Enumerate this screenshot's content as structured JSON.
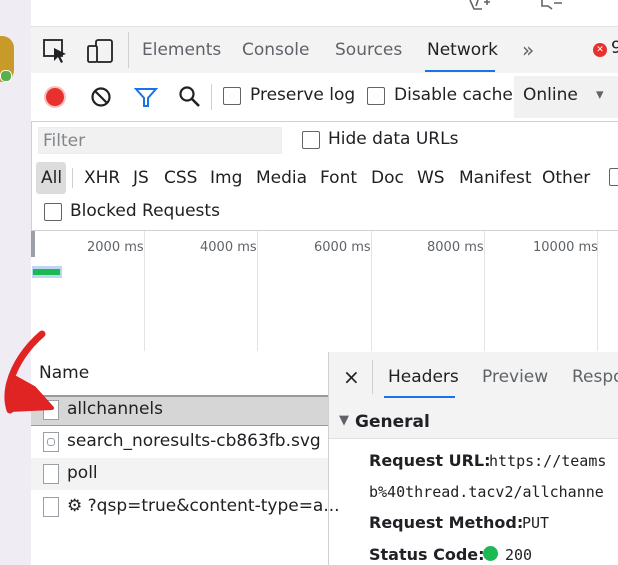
{
  "devtools": {
    "tabs": [
      {
        "label": "Elements"
      },
      {
        "label": "Console"
      },
      {
        "label": "Sources"
      },
      {
        "label": "Network"
      }
    ],
    "more_tabs_glyph": "»",
    "error_glyph": "✕",
    "error_count": "9"
  },
  "toolbar": {
    "preserve_log": "Preserve log",
    "disable_cache": "Disable cache",
    "throttle": "Online",
    "throttle_caret": "▾"
  },
  "filter": {
    "placeholder": "Filter",
    "hide_data_urls": "Hide data URLs",
    "types": [
      "All",
      "XHR",
      "JS",
      "CSS",
      "Img",
      "Media",
      "Font",
      "Doc",
      "WS",
      "Manifest",
      "Other"
    ],
    "blocked_requests": "Blocked Requests"
  },
  "timeline": {
    "ticks": [
      "2000 ms",
      "4000 ms",
      "6000 ms",
      "8000 ms",
      "10000 ms"
    ]
  },
  "requests": {
    "column_name": "Name",
    "rows": [
      {
        "name": "allchannels"
      },
      {
        "name": "search_noresults-cb863fb.svg"
      },
      {
        "name": "poll"
      },
      {
        "name": "⚙ ?qsp=true&content-type=a..."
      }
    ]
  },
  "details": {
    "close_glyph": "×",
    "tabs": [
      {
        "label": "Headers"
      },
      {
        "label": "Preview"
      },
      {
        "label": "Respo"
      }
    ],
    "section_caret": "▼",
    "section_title": "General",
    "request_url_key": "Request URL:",
    "request_url_val": "https://teams",
    "request_url_cont": "b%40thread.tacv2/allchanne",
    "request_method_key": "Request Method:",
    "request_method_val": "PUT",
    "status_code_key": "Status Code:",
    "status_code_val": "200"
  },
  "colors": {
    "accent": "#1a73e8",
    "record": "#e8312f",
    "status_ok": "#1db954",
    "annotation": "#e02424"
  }
}
